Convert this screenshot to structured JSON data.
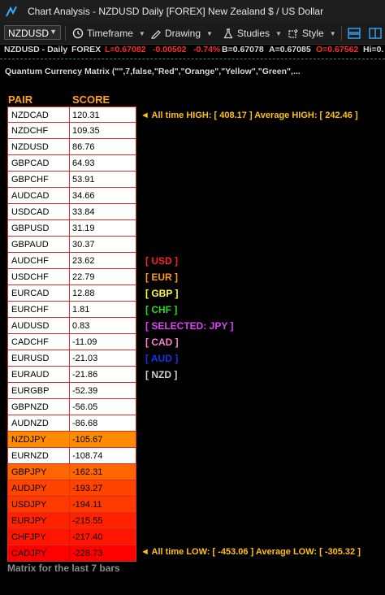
{
  "window": {
    "title": "Chart Analysis - NZDUSD Daily [FOREX] New Zealand $ / US Dollar"
  },
  "toolbar": {
    "symbol": "NZDUSD",
    "timeframe_label": "Timeframe",
    "drawing_label": "Drawing",
    "studies_label": "Studies",
    "style_label": "Style"
  },
  "quote": {
    "symbol": "NZDUSD - Daily",
    "market": "FOREX",
    "last": "L=0.67082",
    "change": "-0.00502",
    "change_pct": "-0.74%",
    "bid": "B=0.67078",
    "ask": "A=0.67085",
    "open": "O=0.67562",
    "high": "Hi=0.",
    "colors": {
      "neutral": "#d8d8d8",
      "negative": "#ff2b2b"
    }
  },
  "study": {
    "name": "Quantum Currency Matrix (\"\",7,false,\"Red\",\"Orange\",\"Yellow\",\"Green\",..."
  },
  "matrix": {
    "header_pair": "PAIR",
    "header_score": "SCORE",
    "rows": [
      {
        "pair": "NZDCAD",
        "score": "120.31",
        "bg": "#ffffff",
        "fg": "#000000"
      },
      {
        "pair": "NZDCHF",
        "score": "109.35",
        "bg": "#ffffff",
        "fg": "#000000"
      },
      {
        "pair": "NZDUSD",
        "score": "86.76",
        "bg": "#ffffff",
        "fg": "#000000"
      },
      {
        "pair": "GBPCAD",
        "score": "64.93",
        "bg": "#ffffff",
        "fg": "#000000"
      },
      {
        "pair": "GBPCHF",
        "score": "53.91",
        "bg": "#ffffff",
        "fg": "#000000"
      },
      {
        "pair": "AUDCAD",
        "score": "34.66",
        "bg": "#ffffff",
        "fg": "#000000"
      },
      {
        "pair": "USDCAD",
        "score": "33.84",
        "bg": "#ffffff",
        "fg": "#000000"
      },
      {
        "pair": "GBPUSD",
        "score": "31.19",
        "bg": "#ffffff",
        "fg": "#000000"
      },
      {
        "pair": "GBPAUD",
        "score": "30.37",
        "bg": "#ffffff",
        "fg": "#000000"
      },
      {
        "pair": "AUDCHF",
        "score": "23.62",
        "bg": "#ffffff",
        "fg": "#000000"
      },
      {
        "pair": "USDCHF",
        "score": "22.79",
        "bg": "#ffffff",
        "fg": "#000000"
      },
      {
        "pair": "EURCAD",
        "score": "12.88",
        "bg": "#ffffff",
        "fg": "#000000"
      },
      {
        "pair": "EURCHF",
        "score": "1.81",
        "bg": "#ffffff",
        "fg": "#000000"
      },
      {
        "pair": "AUDUSD",
        "score": "0.83",
        "bg": "#ffffff",
        "fg": "#000000"
      },
      {
        "pair": "CADCHF",
        "score": "-11.09",
        "bg": "#ffffff",
        "fg": "#000000"
      },
      {
        "pair": "EURUSD",
        "score": "-21.03",
        "bg": "#ffffff",
        "fg": "#000000"
      },
      {
        "pair": "EURAUD",
        "score": "-21.86",
        "bg": "#ffffff",
        "fg": "#000000"
      },
      {
        "pair": "EURGBP",
        "score": "-52.39",
        "bg": "#ffffff",
        "fg": "#000000"
      },
      {
        "pair": "GBPNZD",
        "score": "-56.05",
        "bg": "#ffffff",
        "fg": "#000000"
      },
      {
        "pair": "AUDNZD",
        "score": "-86.68",
        "bg": "#ffffff",
        "fg": "#000000"
      },
      {
        "pair": "NZDJPY",
        "score": "-105.67",
        "bg": "#ff8c00",
        "fg": "#000000"
      },
      {
        "pair": "EURNZD",
        "score": "-108.74",
        "bg": "#ffffff",
        "fg": "#000000"
      },
      {
        "pair": "GBPJPY",
        "score": "-162.31",
        "bg": "#ff6600",
        "fg": "#000000"
      },
      {
        "pair": "AUDJPY",
        "score": "-193.27",
        "bg": "#ff4400",
        "fg": "#000000"
      },
      {
        "pair": "USDJPY",
        "score": "-194.11",
        "bg": "#ff3a00",
        "fg": "#000000"
      },
      {
        "pair": "EURJPY",
        "score": "-215.55",
        "bg": "#ff2200",
        "fg": "#000000"
      },
      {
        "pair": "CHFJPY",
        "score": "-217.40",
        "bg": "#ff1500",
        "fg": "#000000"
      },
      {
        "pair": "CADJPY",
        "score": "-228.73",
        "bg": "#ff0000",
        "fg": "#000000"
      }
    ]
  },
  "notes": {
    "high_text": "◄ All time HIGH: [  408.17  ] Average HIGH: [  242.46  ]",
    "low_text": "◄ All time LOW: [  -453.06  ] Average LOW: [  -305.32  ]"
  },
  "legend": [
    {
      "label": "[ USD ]",
      "color": "#ff2020"
    },
    {
      "label": "[ EUR ]",
      "color": "#ff9a1a"
    },
    {
      "label": "[ GBP ]",
      "color": "#ffff33"
    },
    {
      "label": "[ CHF ]",
      "color": "#22dd22"
    },
    {
      "label": "[ SELECTED: JPY ]",
      "color": "#e040fb"
    },
    {
      "label": "[ CAD ]",
      "color": "#ff7fd0"
    },
    {
      "label": "[ AUD ]",
      "color": "#1133ee"
    },
    {
      "label": "[ NZD ]",
      "color": "#cfcfcf"
    }
  ],
  "footer": "Matrix for the last 7 bars"
}
